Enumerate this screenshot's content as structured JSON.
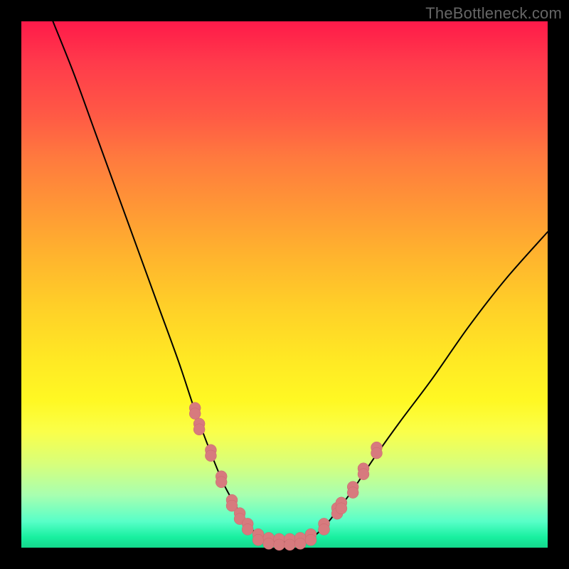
{
  "watermark": "TheBottleneck.com",
  "colors": {
    "marker_fill": "#d77a7e",
    "marker_stroke": "#c9686c",
    "curve_stroke": "#000000"
  },
  "chart_data": {
    "type": "line",
    "title": "",
    "xlabel": "",
    "ylabel": "",
    "xlim": [
      0,
      100
    ],
    "ylim": [
      0,
      100
    ],
    "grid": false,
    "legend": false,
    "series": [
      {
        "name": "left-curve",
        "type": "line",
        "x": [
          6,
          10,
          14,
          18,
          22,
          26,
          30,
          33,
          36,
          38.5,
          41,
          43,
          45,
          47
        ],
        "y": [
          100,
          90,
          79,
          68,
          57,
          46,
          35,
          26,
          18,
          12,
          7.5,
          4.5,
          2.3,
          1.2
        ]
      },
      {
        "name": "right-curve",
        "type": "line",
        "x": [
          54,
          56,
          58,
          60,
          63,
          67,
          72,
          78,
          85,
          92,
          100
        ],
        "y": [
          1.2,
          2.5,
          4.5,
          7,
          11,
          17,
          24,
          32,
          42,
          51,
          60
        ]
      },
      {
        "name": "flat-bottom",
        "type": "line",
        "x": [
          47,
          49.5,
          52,
          54
        ],
        "y": [
          1.2,
          1.0,
          1.0,
          1.2
        ]
      },
      {
        "name": "left-markers",
        "type": "scatter",
        "x": [
          33.0,
          33.8,
          36.0,
          38.0,
          40.0,
          41.5,
          43.0
        ],
        "y": [
          26.0,
          23.0,
          18.0,
          13.0,
          8.5,
          6.0,
          4.0
        ]
      },
      {
        "name": "bottom-markers",
        "type": "scatter",
        "x": [
          45.0,
          47.0,
          49.0,
          51.0,
          53.0,
          55.0
        ],
        "y": [
          2.0,
          1.3,
          1.1,
          1.1,
          1.3,
          2.0
        ]
      },
      {
        "name": "right-markers",
        "type": "scatter",
        "x": [
          57.5,
          60.0,
          60.8,
          63.0,
          65.0,
          67.5
        ],
        "y": [
          4.0,
          7.0,
          8.0,
          11.0,
          14.5,
          18.5
        ]
      }
    ]
  }
}
